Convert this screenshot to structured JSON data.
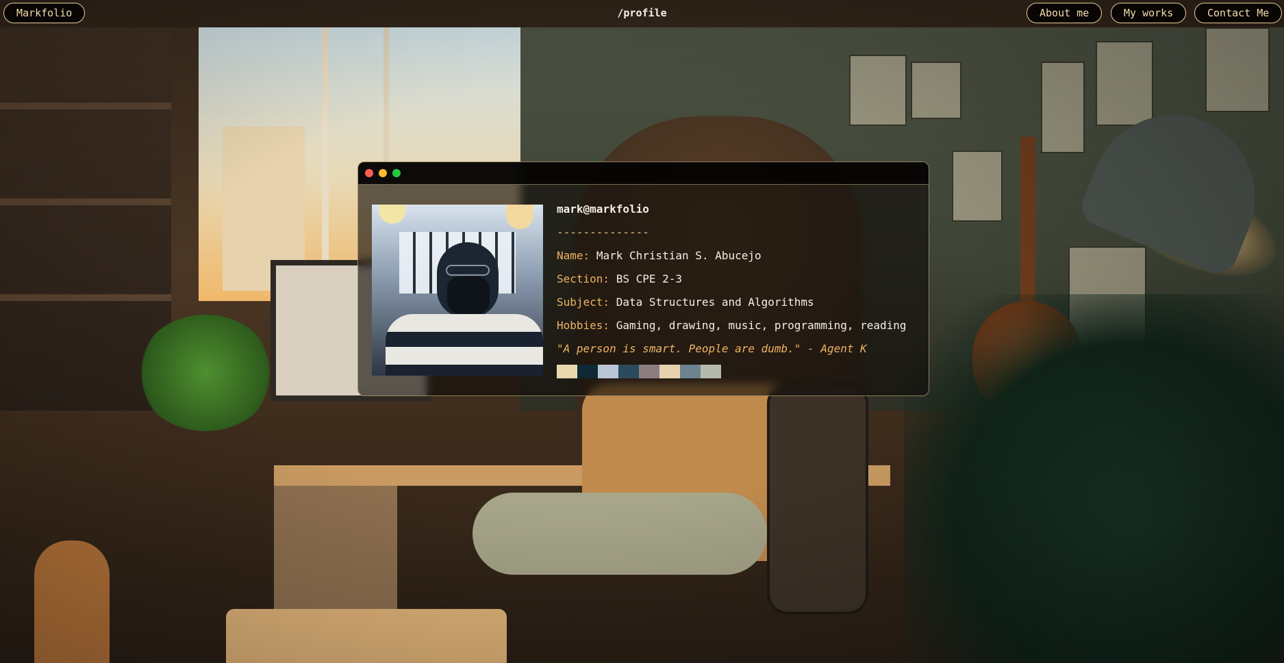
{
  "nav": {
    "brand": "Markfolio",
    "route": "/profile",
    "links": [
      {
        "label": "About me"
      },
      {
        "label": "My works"
      },
      {
        "label": "Contact Me"
      }
    ]
  },
  "terminal": {
    "window_dots": [
      "#ff5f57",
      "#febc2e",
      "#28c840"
    ],
    "user_host": "mark@markfolio",
    "separator": "--------------",
    "fields": [
      {
        "key": "Name:",
        "value": "Mark Christian S. Abucejo"
      },
      {
        "key": "Section:",
        "value": "BS CPE 2-3"
      },
      {
        "key": "Subject:",
        "value": "Data Structures and Algorithms"
      },
      {
        "key": "Hobbies:",
        "value": "Gaming, drawing, music, programming, reading"
      }
    ],
    "quote": "\"A person is smart. People are dumb.\" - Agent K",
    "palette": [
      "#e8d8b0",
      "#0d2a34",
      "#b9c6d6",
      "#2c4a5e",
      "#8c7d80",
      "#e9d2b0",
      "#6d8390",
      "#b5b8ad"
    ]
  },
  "colors": {
    "accent": "#f0b463",
    "border": "#e7cf9a",
    "text": "#f4efe4"
  }
}
